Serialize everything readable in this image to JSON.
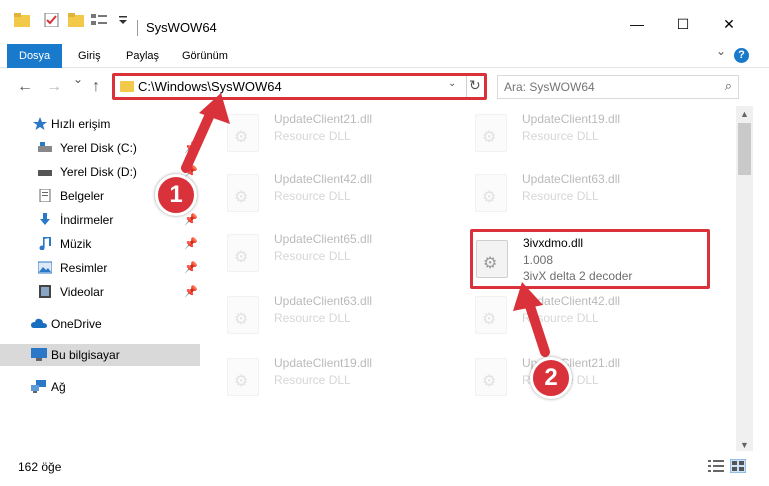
{
  "window": {
    "title": "SysWOW64",
    "minimize": "—",
    "maximize": "☐",
    "close": "✕"
  },
  "ribbon": {
    "tabs": [
      {
        "label": "Dosya",
        "active": true
      },
      {
        "label": "Giriş",
        "active": false
      },
      {
        "label": "Paylaş",
        "active": false
      },
      {
        "label": "Görünüm",
        "active": false
      }
    ],
    "expand": "⌄",
    "help": "?"
  },
  "nav": {
    "back": "←",
    "forward": "→",
    "recent": "⌄",
    "up": "↑",
    "address": "C:\\Windows\\SysWOW64",
    "address_drop": "⌄",
    "refresh": "↻",
    "search_placeholder": "Ara: SysWOW64",
    "search_icon": "⌕"
  },
  "sidebar": {
    "items": [
      {
        "label": "Hızlı erişim",
        "icon": "star-icon"
      },
      {
        "label": "Yerel Disk (C:)",
        "icon": "drive-icon",
        "pinned": true
      },
      {
        "label": "Yerel Disk (D:)",
        "icon": "drive-icon",
        "pinned": true
      },
      {
        "label": "Belgeler",
        "icon": "documents-icon",
        "pinned": true
      },
      {
        "label": "İndirmeler",
        "icon": "download-icon",
        "pinned": true
      },
      {
        "label": "Müzik",
        "icon": "music-icon",
        "pinned": true
      },
      {
        "label": "Resimler",
        "icon": "pictures-icon",
        "pinned": true
      },
      {
        "label": "Videolar",
        "icon": "videos-icon",
        "pinned": true
      },
      {
        "label": "OneDrive",
        "icon": "cloud-icon"
      },
      {
        "label": "Bu bilgisayar",
        "icon": "computer-icon",
        "selected": true
      },
      {
        "label": "Ağ",
        "icon": "network-icon"
      }
    ],
    "pin_glyph": "📌"
  },
  "files": [
    {
      "name": "UpdateClient21.dll",
      "desc": "Resource DLL"
    },
    {
      "name": "UpdateClient19.dll",
      "desc": "Resource DLL"
    },
    {
      "name": "UpdateClient42.dll",
      "desc": "Resource DLL"
    },
    {
      "name": "UpdateClient63.dll",
      "desc": "Resource DLL"
    },
    {
      "name": "UpdateClient65.dll",
      "desc": "Resource DLL"
    },
    {
      "name": "3ivxdmo.dll",
      "desc": "1.008",
      "sub": "3ivX delta 2 decoder",
      "highlighted": true
    },
    {
      "name": "UpdateClient63.dll",
      "desc": "Resource DLL"
    },
    {
      "name": "UpdateClient42.dll",
      "desc": "Resource DLL"
    },
    {
      "name": "UpdateClient19.dll",
      "desc": "Resource DLL"
    },
    {
      "name": "UpdateClient21.dll",
      "desc": "Resource DLL"
    }
  ],
  "status": {
    "count": "162 öğe"
  },
  "annotations": {
    "step1": "1",
    "step2": "2",
    "color": "#d9323a"
  },
  "colors": {
    "accent": "#1979ca",
    "highlight": "#d9323a",
    "folder": "#f3c94a"
  }
}
